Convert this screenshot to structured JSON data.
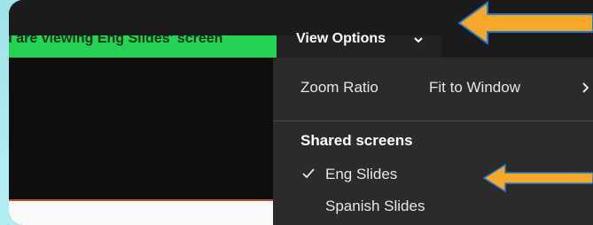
{
  "banner": {
    "text": "u are viewing Eng Slides' screen"
  },
  "toolbar": {
    "view_options_label": "View Options",
    "chevron_icon": "chevron-down-icon"
  },
  "menu": {
    "zoom": {
      "label": "Zoom Ratio",
      "value": "Fit to Window",
      "icon": "chevron-right-icon"
    },
    "shared_screens": {
      "heading": "Shared screens",
      "items": [
        {
          "label": "Eng Slides",
          "selected": true,
          "icon": "check-icon"
        },
        {
          "label": "Spanish Slides",
          "selected": false
        }
      ]
    }
  },
  "annotations": {
    "arrow_color": "#f5a82a",
    "arrow_outline": "#2a78c8",
    "icon": "arrow-left-icon"
  },
  "colors": {
    "banner_green": "#24d255",
    "menu_bg": "#2b2b2b",
    "content_bg": "#0e0e0e",
    "accent_line": "#c2532c"
  }
}
